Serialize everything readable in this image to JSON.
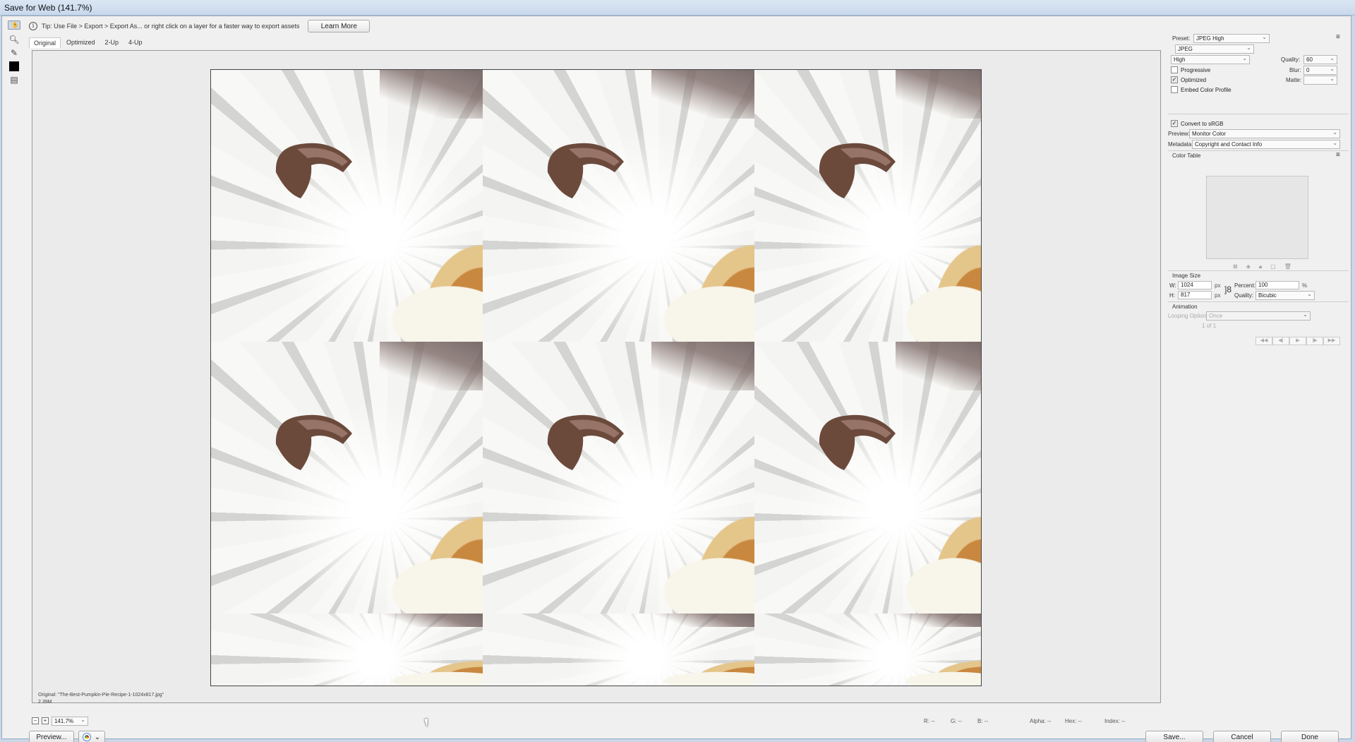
{
  "window": {
    "title": "Save for Web (141.7%)"
  },
  "tip": {
    "text": "Tip: Use File > Export > Export As...  or right click on a layer for a faster way to export assets",
    "button": "Learn More"
  },
  "view_tabs": [
    "Original",
    "Optimized",
    "2-Up",
    "4-Up"
  ],
  "tools": [
    "hand-icon",
    "slice-select-icon",
    "zoom-icon",
    "eyedropper-icon",
    "color-swatch",
    "toggle-slices-icon"
  ],
  "original_caption": {
    "name": "Original: \"The-Best-Pumpkin-Pie-Recipe-1-1024x817.jpg\"",
    "size": "2.39M"
  },
  "settings": {
    "preset_label": "Preset:",
    "preset": "JPEG High",
    "format": "JPEG",
    "quality_level": "High",
    "quality_label": "Quality:",
    "quality": "60",
    "blur_label": "Blur:",
    "blur": "0",
    "matte_label": "Matte:",
    "progressive": {
      "label": "Progressive",
      "checked": false
    },
    "optimized": {
      "label": "Optimized",
      "checked": true
    },
    "embed_profile": {
      "label": "Embed Color Profile",
      "checked": false
    },
    "convert_srgb": {
      "label": "Convert to sRGB",
      "checked": true
    },
    "preview_label": "Preview:",
    "preview": "Monitor Color",
    "metadata_label": "Metadata:",
    "metadata": "Copyright and Contact Info"
  },
  "color_table": {
    "title": "Color Table"
  },
  "image_size": {
    "title": "Image Size",
    "w_label": "W:",
    "w": "1024",
    "h_label": "H:",
    "h": "817",
    "unit": "px",
    "percent_label": "Percent:",
    "percent": "100",
    "percent_unit": "%",
    "quality_label": "Quality:",
    "quality": "Bicubic"
  },
  "animation": {
    "title": "Animation",
    "looping_label": "Looping Options:",
    "looping": "Once",
    "frame": "1 of 1"
  },
  "status": {
    "zoom": "141.7%",
    "r": "R: --",
    "g": "G: --",
    "b": "B: --",
    "alpha": "Alpha: --",
    "hex": "Hex: --",
    "index": "Index: --"
  },
  "buttons": {
    "preview": "Preview...",
    "save": "Save...",
    "cancel": "Cancel",
    "done": "Done"
  }
}
